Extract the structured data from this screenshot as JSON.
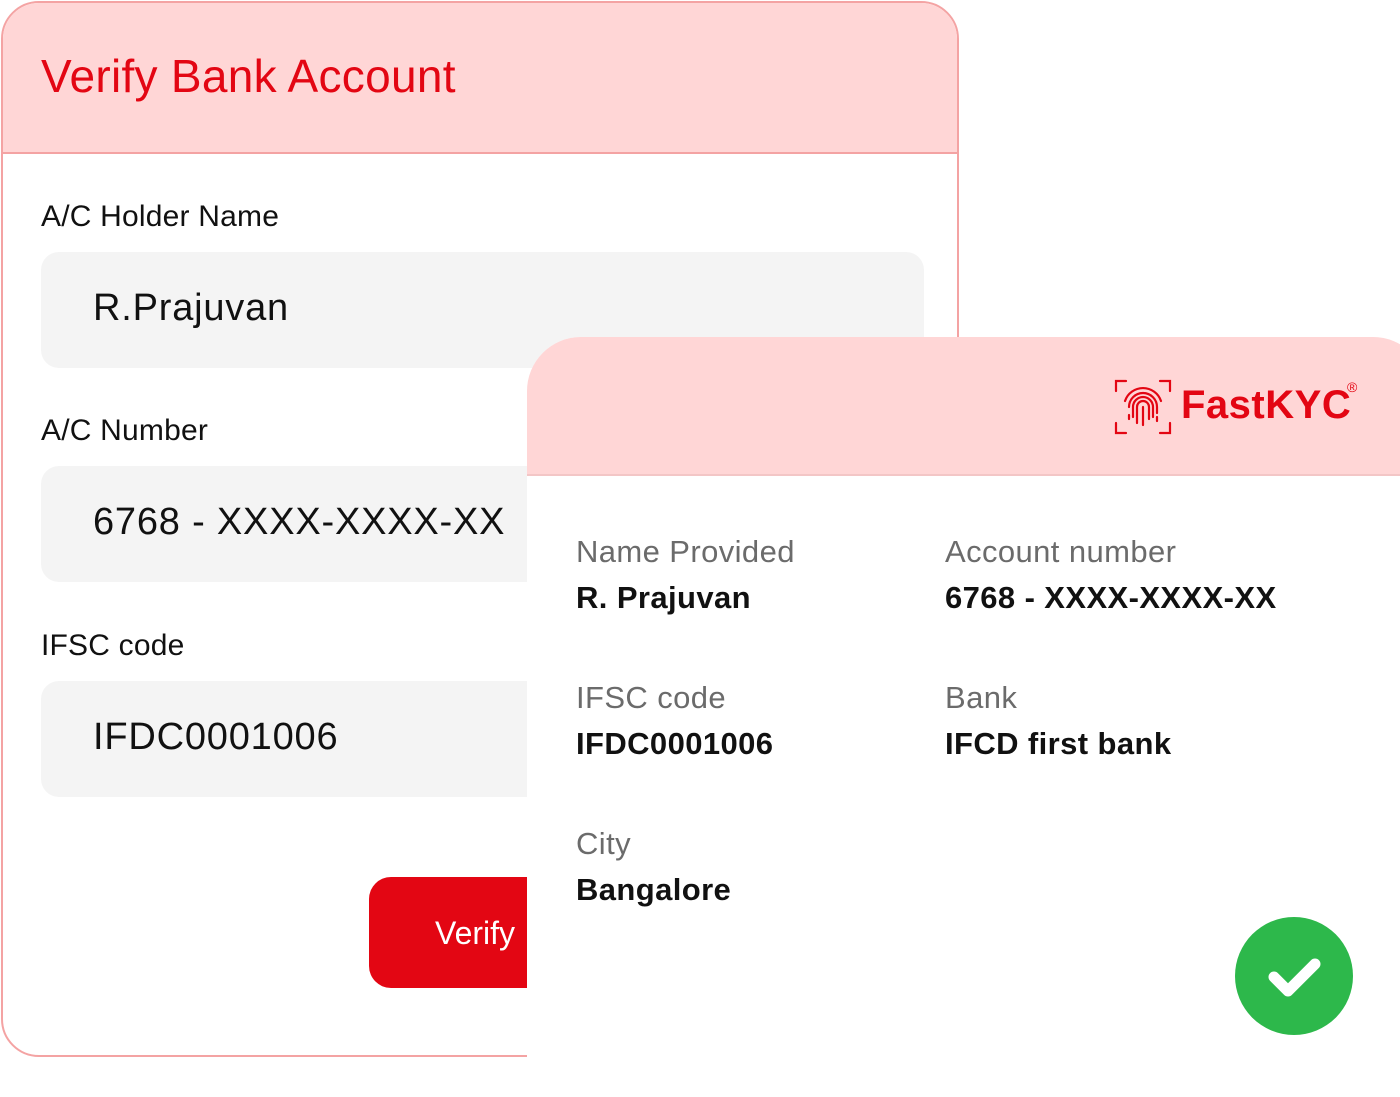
{
  "form": {
    "title": "Verify Bank Account",
    "fields": [
      {
        "label": "A/C Holder Name",
        "value": "R.Prajuvan"
      },
      {
        "label": "A/C Number",
        "value": "6768 - XXXX-XXXX-XX"
      },
      {
        "label": "IFSC code",
        "value": "IFDC0001006"
      }
    ],
    "verify_label": "Verify"
  },
  "result": {
    "brand_name": "FastKYC",
    "brand_mark": "®",
    "brand_icon": "fingerprint-icon",
    "details": {
      "name": {
        "label": "Name Provided",
        "value": "R. Prajuvan"
      },
      "account": {
        "label": "Account number",
        "value": "6768 - XXXX-XXXX-XX"
      },
      "ifsc": {
        "label": "IFSC code",
        "value": "IFDC0001006"
      },
      "bank": {
        "label": "Bank",
        "value": "IFCD first bank"
      },
      "city": {
        "label": "City",
        "value": "Bangalore"
      }
    },
    "status_icon": "check-circle-icon"
  },
  "colors": {
    "accent": "#e30613",
    "header_bg": "#ffd6d6",
    "field_bg": "#f4f4f4",
    "success": "#2db84b"
  }
}
